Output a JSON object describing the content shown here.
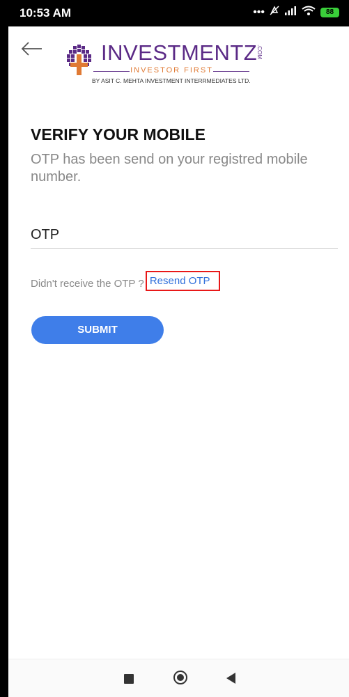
{
  "status_bar": {
    "time": "10:53 AM",
    "battery": "88",
    "icons": [
      "more-icon",
      "mute-icon",
      "signal-icon",
      "wifi-icon",
      "battery-icon"
    ]
  },
  "header": {
    "back_icon": "arrow-left-icon",
    "logo": {
      "brand": "INVESTMENTZ",
      "brand_suffix": ".COM",
      "tagline": "INVESTOR FIRST",
      "subline": "BY ASIT C. MEHTA INVESTMENT INTERRMEDIATES LTD."
    }
  },
  "main": {
    "title": "VERIFY YOUR MOBILE",
    "description": "OTP has been send on your registred mobile number.",
    "otp_field": {
      "placeholder": "OTP",
      "value": ""
    },
    "resend_prompt": "Didn't receive the OTP ?",
    "resend_link": "Resend OTP",
    "submit_label": "SUBMIT"
  },
  "colors": {
    "primary_button": "#3f7ee9",
    "link": "#2f6fdb",
    "brand_purple": "#5b2a86",
    "brand_orange": "#e07a34",
    "highlight_box": "#e81818"
  },
  "nav_bar": {
    "icons": [
      "recent-apps-icon",
      "home-icon",
      "back-icon"
    ]
  }
}
